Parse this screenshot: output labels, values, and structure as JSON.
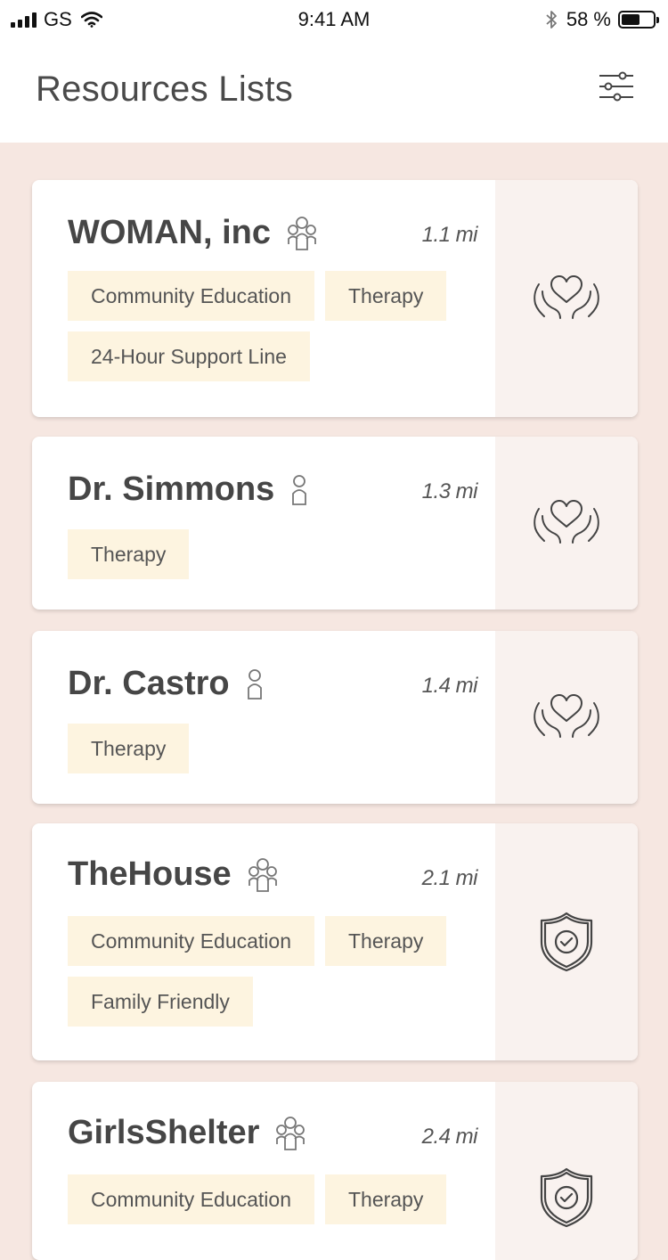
{
  "status_bar": {
    "carrier": "GS",
    "time": "9:41 AM",
    "battery_percent_text": "58 %",
    "battery_level": 0.58
  },
  "header": {
    "title": "Resources Lists",
    "filter_icon": "sliders-icon"
  },
  "resources": [
    {
      "name": "WOMAN, inc",
      "distance": "1.1 mi",
      "type_icon": "group-icon",
      "tags": [
        "Community Education",
        "Therapy",
        "24-Hour Support Line"
      ],
      "category_icon": "heart-hands-icon"
    },
    {
      "name": "Dr. Simmons",
      "distance": "1.3 mi",
      "type_icon": "person-icon",
      "tags": [
        "Therapy"
      ],
      "category_icon": "heart-hands-icon"
    },
    {
      "name": "Dr. Castro",
      "distance": "1.4 mi",
      "type_icon": "person-icon",
      "tags": [
        "Therapy"
      ],
      "category_icon": "heart-hands-icon"
    },
    {
      "name": "TheHouse",
      "distance": "2.1 mi",
      "type_icon": "group-icon",
      "tags": [
        "Community Education",
        "Therapy",
        "Family Friendly"
      ],
      "category_icon": "shield-check-icon"
    },
    {
      "name": "GirlsShelter",
      "distance": "2.4 mi",
      "type_icon": "group-icon",
      "tags": [
        "Community Education",
        "Therapy"
      ],
      "category_icon": "shield-check-icon"
    }
  ]
}
